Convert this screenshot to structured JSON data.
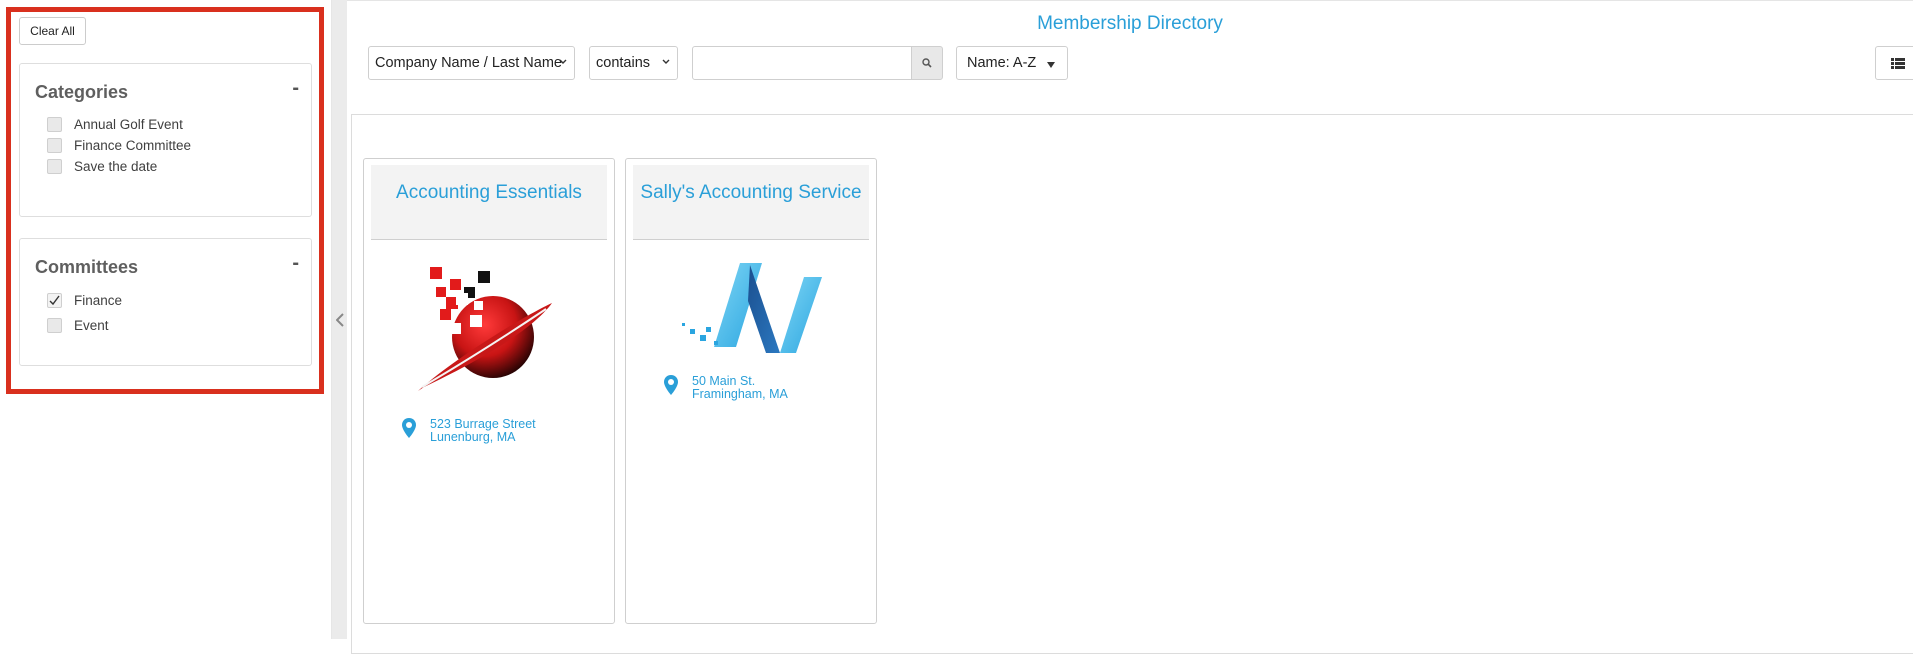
{
  "filters": {
    "clear_all": "Clear All",
    "categories": {
      "title": "Categories",
      "collapse": "-",
      "items": [
        {
          "label": "Annual Golf Event",
          "checked": false
        },
        {
          "label": "Finance Committee",
          "checked": false
        },
        {
          "label": "Save the date",
          "checked": false
        }
      ]
    },
    "committees": {
      "title": "Committees",
      "collapse": "-",
      "items": [
        {
          "label": "Finance",
          "checked": true
        },
        {
          "label": "Event",
          "checked": false
        }
      ]
    }
  },
  "header": {
    "title": "Membership Directory",
    "field_select": "Company Name / Last Name",
    "operator_select": "contains",
    "search_value": "",
    "sort": "Name: A-Z"
  },
  "members": [
    {
      "name": "Accounting Essentials",
      "logo": "red-planet-logo",
      "address_line1": "523 Burrage Street",
      "address_line2": "Lunenburg, MA"
    },
    {
      "name": "Sally's Accounting Service",
      "logo": "blue-n-logo",
      "address_line1": "50 Main St.",
      "address_line2": "Framingham, MA"
    }
  ],
  "icons": {
    "search": "search-icon",
    "list_view": "list-view-icon",
    "pin": "map-pin-icon",
    "collapse_sidebar": "chevron-left-icon"
  },
  "colors": {
    "accent": "#2a9fd8",
    "highlight": "#d9301e"
  }
}
